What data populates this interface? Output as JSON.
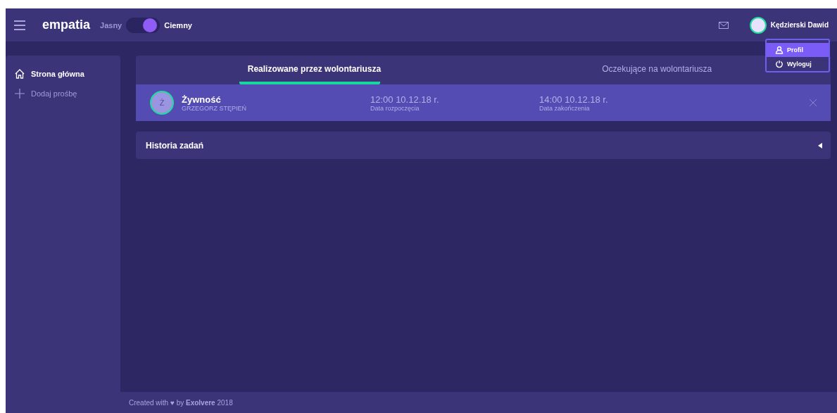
{
  "header": {
    "brand": "empatia",
    "theme_toggle": {
      "left_label": "Jasny",
      "right_label": "Ciemny",
      "on": true
    },
    "user": {
      "name": "Kędzierski Dawid"
    }
  },
  "user_menu": {
    "items": [
      {
        "label": "Profil",
        "kind": "profile",
        "selected": true
      },
      {
        "label": "Wyloguj",
        "kind": "logout",
        "selected": false
      }
    ]
  },
  "sidebar": {
    "items": [
      {
        "label": "Strona główna",
        "kind": "home",
        "selected": true
      },
      {
        "label": "Dodaj prośbę",
        "kind": "add",
        "selected": false
      }
    ]
  },
  "tabs": [
    {
      "label": "Realizowane przez wolontariusza",
      "selected": true
    },
    {
      "label": "Oczekujące na wolontariusza",
      "selected": false
    }
  ],
  "tasks": [
    {
      "avatar_letter": "Ż",
      "title": "Żywność",
      "person": "GRZEGORZ STĘPIEŃ",
      "start_time": "12:00 10.12.18 r.",
      "start_label": "Data rozpoczęcia",
      "end_time": "14:00 10.12.18 r.",
      "end_label": "Data zakończenia"
    }
  ],
  "history": {
    "title": "Historia zadań",
    "expanded": false
  },
  "footer": {
    "text": "Created with ♥ by **Exolvere** 2018"
  }
}
